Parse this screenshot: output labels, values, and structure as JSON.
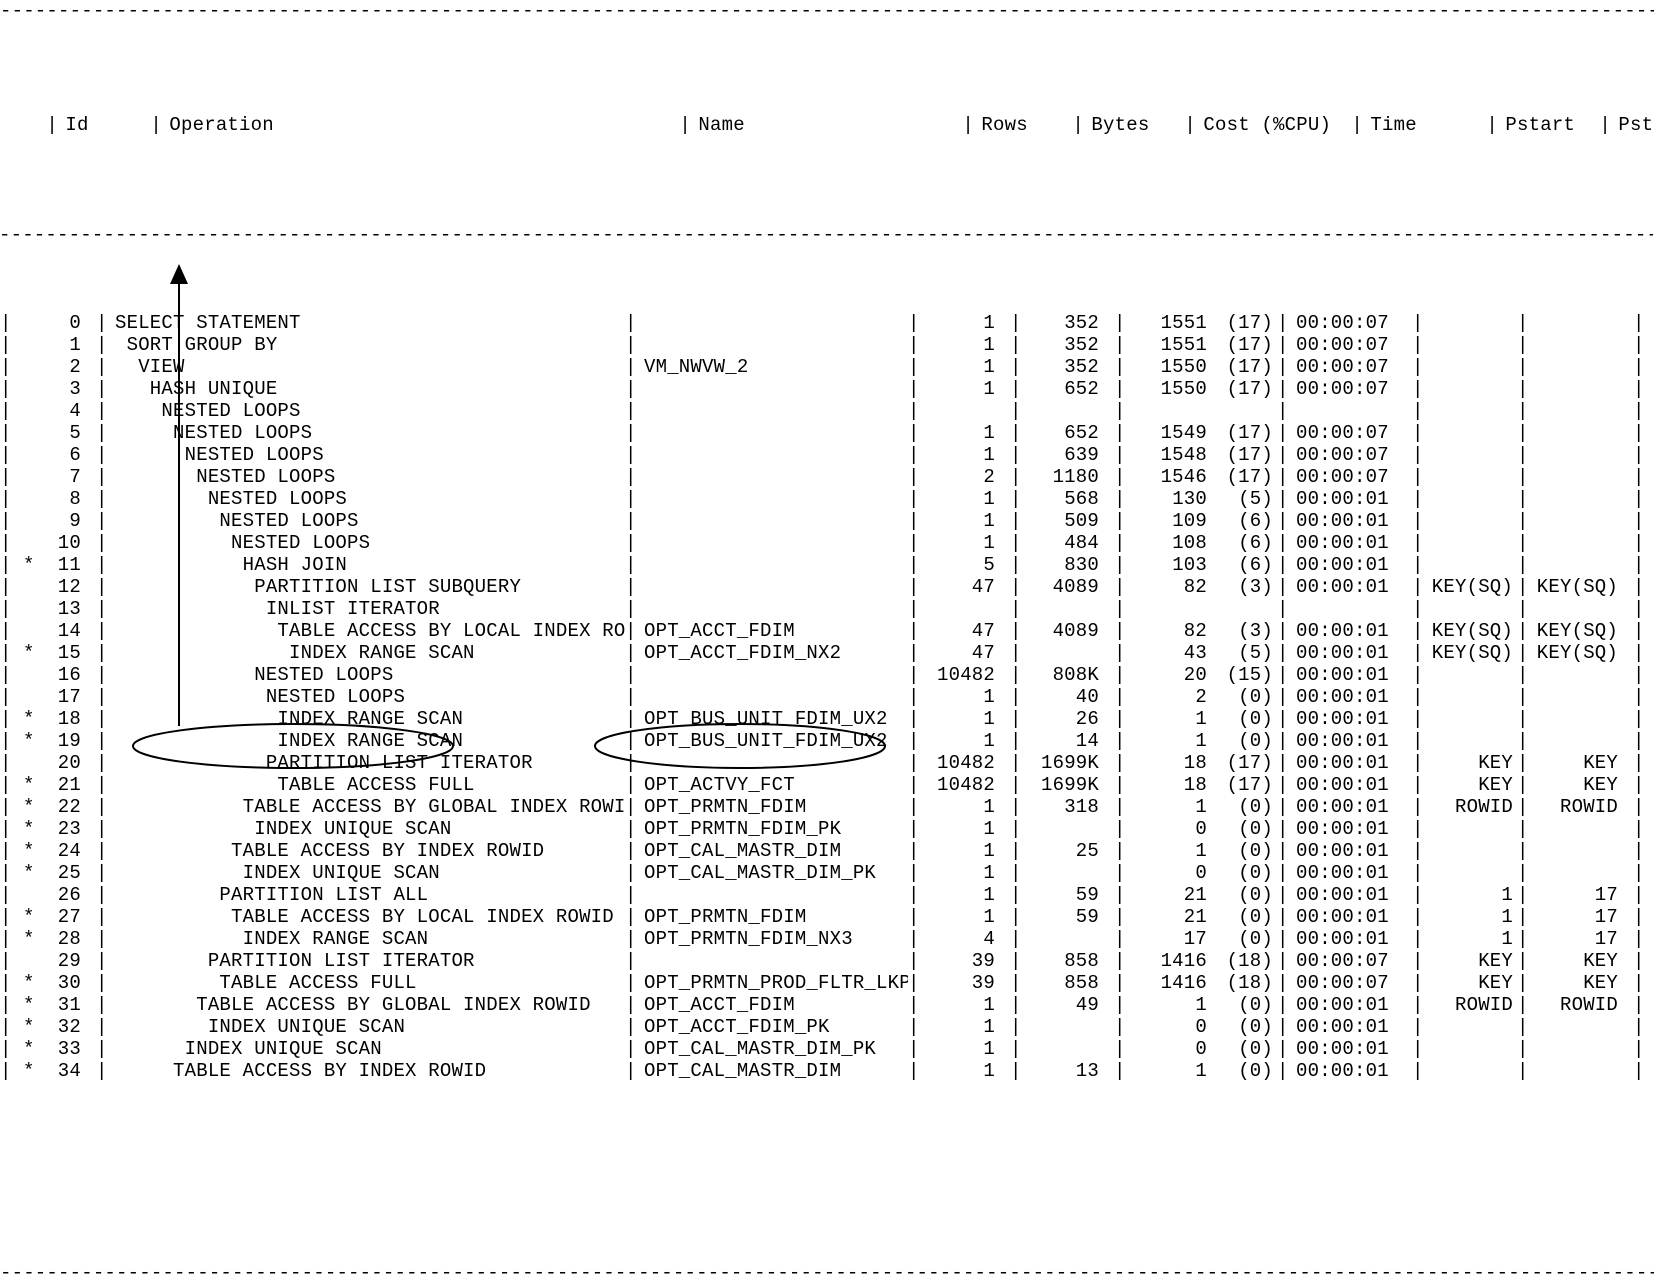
{
  "headers": {
    "id": "Id",
    "operation": "Operation",
    "name": "Name",
    "rows": "Rows",
    "bytes": "Bytes",
    "cost_cpu": "Cost (%CPU)",
    "time": "Time",
    "pstart": "Pstart",
    "pstop": "Pstop"
  },
  "rows": [
    {
      "star": "",
      "id": "0",
      "indent": 0,
      "op": "SELECT STATEMENT",
      "name": "",
      "rows": "1",
      "bytes": "352",
      "cost": "1551",
      "cpu": "(17)",
      "time": "00:00:07",
      "pstart": "",
      "pstop": ""
    },
    {
      "star": "",
      "id": "1",
      "indent": 1,
      "op": "SORT GROUP BY",
      "name": "",
      "rows": "1",
      "bytes": "352",
      "cost": "1551",
      "cpu": "(17)",
      "time": "00:00:07",
      "pstart": "",
      "pstop": ""
    },
    {
      "star": "",
      "id": "2",
      "indent": 2,
      "op": "VIEW",
      "name": "VM_NWVW_2",
      "rows": "1",
      "bytes": "352",
      "cost": "1550",
      "cpu": "(17)",
      "time": "00:00:07",
      "pstart": "",
      "pstop": ""
    },
    {
      "star": "",
      "id": "3",
      "indent": 3,
      "op": "HASH UNIQUE",
      "name": "",
      "rows": "1",
      "bytes": "652",
      "cost": "1550",
      "cpu": "(17)",
      "time": "00:00:07",
      "pstart": "",
      "pstop": ""
    },
    {
      "star": "",
      "id": "4",
      "indent": 4,
      "op": "NESTED LOOPS",
      "name": "",
      "rows": "",
      "bytes": "",
      "cost": "",
      "cpu": "",
      "time": "",
      "pstart": "",
      "pstop": ""
    },
    {
      "star": "",
      "id": "5",
      "indent": 5,
      "op": "NESTED LOOPS",
      "name": "",
      "rows": "1",
      "bytes": "652",
      "cost": "1549",
      "cpu": "(17)",
      "time": "00:00:07",
      "pstart": "",
      "pstop": ""
    },
    {
      "star": "",
      "id": "6",
      "indent": 6,
      "op": "NESTED LOOPS",
      "name": "",
      "rows": "1",
      "bytes": "639",
      "cost": "1548",
      "cpu": "(17)",
      "time": "00:00:07",
      "pstart": "",
      "pstop": ""
    },
    {
      "star": "",
      "id": "7",
      "indent": 7,
      "op": "NESTED LOOPS",
      "name": "",
      "rows": "2",
      "bytes": "1180",
      "cost": "1546",
      "cpu": "(17)",
      "time": "00:00:07",
      "pstart": "",
      "pstop": ""
    },
    {
      "star": "",
      "id": "8",
      "indent": 8,
      "op": "NESTED LOOPS",
      "name": "",
      "rows": "1",
      "bytes": "568",
      "cost": "130",
      "cpu": "(5)",
      "time": "00:00:01",
      "pstart": "",
      "pstop": ""
    },
    {
      "star": "",
      "id": "9",
      "indent": 9,
      "op": "NESTED LOOPS",
      "name": "",
      "rows": "1",
      "bytes": "509",
      "cost": "109",
      "cpu": "(6)",
      "time": "00:00:01",
      "pstart": "",
      "pstop": ""
    },
    {
      "star": "",
      "id": "10",
      "indent": 10,
      "op": "NESTED LOOPS",
      "name": "",
      "rows": "1",
      "bytes": "484",
      "cost": "108",
      "cpu": "(6)",
      "time": "00:00:01",
      "pstart": "",
      "pstop": ""
    },
    {
      "star": "*",
      "id": "11",
      "indent": 11,
      "op": "HASH JOIN",
      "name": "",
      "rows": "5",
      "bytes": "830",
      "cost": "103",
      "cpu": "(6)",
      "time": "00:00:01",
      "pstart": "",
      "pstop": ""
    },
    {
      "star": "",
      "id": "12",
      "indent": 12,
      "op": "PARTITION LIST SUBQUERY",
      "name": "",
      "rows": "47",
      "bytes": "4089",
      "cost": "82",
      "cpu": "(3)",
      "time": "00:00:01",
      "pstart": "KEY(SQ)",
      "pstop": "KEY(SQ)"
    },
    {
      "star": "",
      "id": "13",
      "indent": 13,
      "op": "INLIST ITERATOR",
      "name": "",
      "rows": "",
      "bytes": "",
      "cost": "",
      "cpu": "",
      "time": "",
      "pstart": "",
      "pstop": ""
    },
    {
      "star": "",
      "id": "14",
      "indent": 14,
      "op": "TABLE ACCESS BY LOCAL INDEX ROWID",
      "name": "OPT_ACCT_FDIM",
      "rows": "47",
      "bytes": "4089",
      "cost": "82",
      "cpu": "(3)",
      "time": "00:00:01",
      "pstart": "KEY(SQ)",
      "pstop": "KEY(SQ)"
    },
    {
      "star": "*",
      "id": "15",
      "indent": 15,
      "op": "INDEX RANGE SCAN",
      "name": "OPT_ACCT_FDIM_NX2",
      "rows": "47",
      "bytes": "",
      "cost": "43",
      "cpu": "(5)",
      "time": "00:00:01",
      "pstart": "KEY(SQ)",
      "pstop": "KEY(SQ)"
    },
    {
      "star": "",
      "id": "16",
      "indent": 12,
      "op": "NESTED LOOPS",
      "name": "",
      "rows": "10482",
      "bytes": "808K",
      "cost": "20",
      "cpu": "(15)",
      "time": "00:00:01",
      "pstart": "",
      "pstop": ""
    },
    {
      "star": "",
      "id": "17",
      "indent": 13,
      "op": "NESTED LOOPS",
      "name": "",
      "rows": "1",
      "bytes": "40",
      "cost": "2",
      "cpu": "(0)",
      "time": "00:00:01",
      "pstart": "",
      "pstop": ""
    },
    {
      "star": "*",
      "id": "18",
      "indent": 14,
      "op": "INDEX RANGE SCAN",
      "name": "OPT_BUS_UNIT_FDIM_UX2",
      "rows": "1",
      "bytes": "26",
      "cost": "1",
      "cpu": "(0)",
      "time": "00:00:01",
      "pstart": "",
      "pstop": ""
    },
    {
      "star": "*",
      "id": "19",
      "indent": 14,
      "op": "INDEX RANGE SCAN",
      "name": "OPT_BUS_UNIT_FDIM_UX2",
      "rows": "1",
      "bytes": "14",
      "cost": "1",
      "cpu": "(0)",
      "time": "00:00:01",
      "pstart": "",
      "pstop": ""
    },
    {
      "star": "",
      "id": "20",
      "indent": 13,
      "op": "PARTITION LIST ITERATOR",
      "name": "",
      "rows": "10482",
      "bytes": "1699K",
      "cost": "18",
      "cpu": "(17)",
      "time": "00:00:01",
      "pstart": "KEY",
      "pstop": "KEY"
    },
    {
      "star": "*",
      "id": "21",
      "indent": 14,
      "op": "TABLE ACCESS FULL",
      "name": "OPT_ACTVY_FCT",
      "rows": "10482",
      "bytes": "1699K",
      "cost": "18",
      "cpu": "(17)",
      "time": "00:00:01",
      "pstart": "KEY",
      "pstop": "KEY"
    },
    {
      "star": "*",
      "id": "22",
      "indent": 11,
      "op": "TABLE ACCESS BY GLOBAL INDEX ROWID",
      "name": "OPT_PRMTN_FDIM",
      "rows": "1",
      "bytes": "318",
      "cost": "1",
      "cpu": "(0)",
      "time": "00:00:01",
      "pstart": "ROWID",
      "pstop": "ROWID"
    },
    {
      "star": "*",
      "id": "23",
      "indent": 12,
      "op": "INDEX UNIQUE SCAN",
      "name": "OPT_PRMTN_FDIM_PK",
      "rows": "1",
      "bytes": "",
      "cost": "0",
      "cpu": "(0)",
      "time": "00:00:01",
      "pstart": "",
      "pstop": ""
    },
    {
      "star": "*",
      "id": "24",
      "indent": 10,
      "op": "TABLE ACCESS BY INDEX ROWID",
      "name": "OPT_CAL_MASTR_DIM",
      "rows": "1",
      "bytes": "25",
      "cost": "1",
      "cpu": "(0)",
      "time": "00:00:01",
      "pstart": "",
      "pstop": ""
    },
    {
      "star": "*",
      "id": "25",
      "indent": 11,
      "op": "INDEX UNIQUE SCAN",
      "name": "OPT_CAL_MASTR_DIM_PK",
      "rows": "1",
      "bytes": "",
      "cost": "0",
      "cpu": "(0)",
      "time": "00:00:01",
      "pstart": "",
      "pstop": ""
    },
    {
      "star": "",
      "id": "26",
      "indent": 9,
      "op": "PARTITION LIST ALL",
      "name": "",
      "rows": "1",
      "bytes": "59",
      "cost": "21",
      "cpu": "(0)",
      "time": "00:00:01",
      "pstart": "1",
      "pstop": "17"
    },
    {
      "star": "*",
      "id": "27",
      "indent": 10,
      "op": "TABLE ACCESS BY LOCAL INDEX ROWID",
      "name": "OPT_PRMTN_FDIM",
      "rows": "1",
      "bytes": "59",
      "cost": "21",
      "cpu": "(0)",
      "time": "00:00:01",
      "pstart": "1",
      "pstop": "17"
    },
    {
      "star": "*",
      "id": "28",
      "indent": 11,
      "op": "INDEX RANGE SCAN",
      "name": "OPT_PRMTN_FDIM_NX3",
      "rows": "4",
      "bytes": "",
      "cost": "17",
      "cpu": "(0)",
      "time": "00:00:01",
      "pstart": "1",
      "pstop": "17"
    },
    {
      "star": "",
      "id": "29",
      "indent": 8,
      "op": "PARTITION LIST ITERATOR",
      "name": "",
      "rows": "39",
      "bytes": "858",
      "cost": "1416",
      "cpu": "(18)",
      "time": "00:00:07",
      "pstart": "KEY",
      "pstop": "KEY"
    },
    {
      "star": "*",
      "id": "30",
      "indent": 9,
      "op": "TABLE ACCESS FULL",
      "name": "OPT_PRMTN_PROD_FLTR_LKP",
      "rows": "39",
      "bytes": "858",
      "cost": "1416",
      "cpu": "(18)",
      "time": "00:00:07",
      "pstart": "KEY",
      "pstop": "KEY"
    },
    {
      "star": "*",
      "id": "31",
      "indent": 7,
      "op": "TABLE ACCESS BY GLOBAL INDEX ROWID",
      "name": "OPT_ACCT_FDIM",
      "rows": "1",
      "bytes": "49",
      "cost": "1",
      "cpu": "(0)",
      "time": "00:00:01",
      "pstart": "ROWID",
      "pstop": "ROWID"
    },
    {
      "star": "*",
      "id": "32",
      "indent": 8,
      "op": "INDEX UNIQUE SCAN",
      "name": "OPT_ACCT_FDIM_PK",
      "rows": "1",
      "bytes": "",
      "cost": "0",
      "cpu": "(0)",
      "time": "00:00:01",
      "pstart": "",
      "pstop": ""
    },
    {
      "star": "*",
      "id": "33",
      "indent": 6,
      "op": "INDEX UNIQUE SCAN",
      "name": "OPT_CAL_MASTR_DIM_PK",
      "rows": "1",
      "bytes": "",
      "cost": "0",
      "cpu": "(0)",
      "time": "00:00:01",
      "pstart": "",
      "pstop": ""
    },
    {
      "star": "*",
      "id": "34",
      "indent": 5,
      "op": "TABLE ACCESS BY INDEX ROWID",
      "name": "OPT_CAL_MASTR_DIM",
      "rows": "1",
      "bytes": "13",
      "cost": "1",
      "cpu": "(0)",
      "time": "00:00:01",
      "pstart": "",
      "pstop": ""
    }
  ]
}
